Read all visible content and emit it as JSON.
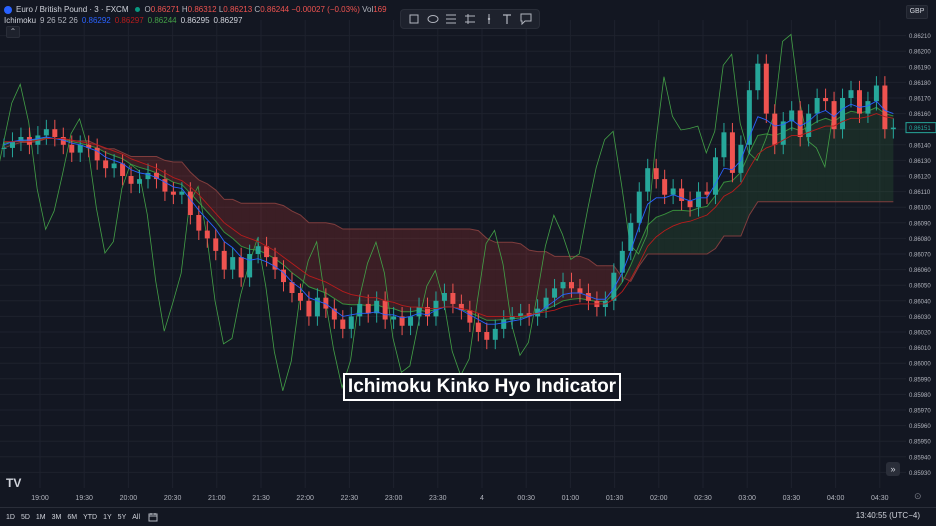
{
  "symbol": {
    "title": "Euro / British Pound · 3 · FXCM",
    "ohlc": [
      {
        "k": "O",
        "v": "0.86271"
      },
      {
        "k": "H",
        "v": "0.86312"
      },
      {
        "k": "L",
        "v": "0.86213"
      },
      {
        "k": "C",
        "v": "0.86244"
      }
    ],
    "change": "−0.00027 (−0.03%)",
    "vol_label": "Vol",
    "vol_value": "169"
  },
  "indicator": {
    "name": "Ichimoku",
    "params": "9 26 52 26",
    "values": [
      {
        "v": "0.86292",
        "color": "#2962ff"
      },
      {
        "v": "0.86297",
        "color": "#b71c1c"
      },
      {
        "v": "0.86244",
        "color": "#43a047"
      },
      {
        "v": "0.86295",
        "color": "#d1d4dc"
      },
      {
        "v": "0.86297",
        "color": "#d1d4dc"
      }
    ]
  },
  "currency": "GBP",
  "overlay_title": "Ichimoku Kinko Hyo Indicator",
  "logo": "TV",
  "toolbar_icons": [
    "rectangle-icon",
    "ellipse-icon",
    "fib-retracement-icon",
    "gann-icon",
    "vertical-line-icon",
    "text-icon",
    "callout-icon"
  ],
  "ranges": [
    "1D",
    "5D",
    "1M",
    "3M",
    "6M",
    "YTD",
    "1Y",
    "5Y",
    "All"
  ],
  "clock": "13:40:55 (UTC−4)",
  "colors": {
    "background": "#131722",
    "up": "#26a69a",
    "down": "#ef5350",
    "tenkan": "#2962ff",
    "kijun": "#b71c1c",
    "chikou": "#43a047",
    "cloud_bull": "rgba(67,160,71,0.15)",
    "cloud_bear": "rgba(244,67,54,0.18)"
  },
  "chart_data": {
    "type": "candlestick",
    "ylim": [
      0.8592,
      0.8622
    ],
    "y_ticks": [
      0.8593,
      0.8594,
      0.8595,
      0.8596,
      0.8597,
      0.8598,
      0.8599,
      0.86,
      0.8601,
      0.8602,
      0.8603,
      0.8604,
      0.8605,
      0.8606,
      0.8607,
      0.8608,
      0.8609,
      0.861,
      0.8611,
      0.8612,
      0.8613,
      0.8614,
      0.8615,
      0.8616,
      0.8617,
      0.8618,
      0.8619,
      0.862,
      0.8621
    ],
    "x_tick_labels": [
      "19:00",
      "19:30",
      "20:00",
      "20:30",
      "21:00",
      "21:30",
      "22:00",
      "22:30",
      "23:00",
      "23:30",
      "4",
      "00:30",
      "01:00",
      "01:30",
      "02:00",
      "02:30",
      "03:00",
      "03:30",
      "04:00",
      "04:30"
    ],
    "current_price": 0.86151,
    "current_price_label": "0.86151",
    "close": [
      0.86138,
      0.86142,
      0.86145,
      0.8614,
      0.86146,
      0.8615,
      0.86145,
      0.8614,
      0.86135,
      0.8614,
      0.86138,
      0.8613,
      0.86125,
      0.86128,
      0.8612,
      0.86115,
      0.86118,
      0.86122,
      0.86118,
      0.8611,
      0.86108,
      0.8611,
      0.86095,
      0.86085,
      0.8608,
      0.86072,
      0.8606,
      0.86068,
      0.86055,
      0.8607,
      0.86075,
      0.86068,
      0.8606,
      0.86052,
      0.86045,
      0.8604,
      0.8603,
      0.86042,
      0.86035,
      0.86028,
      0.86022,
      0.8603,
      0.86038,
      0.86032,
      0.8604,
      0.86028,
      0.8603,
      0.86024,
      0.8603,
      0.86036,
      0.8603,
      0.8604,
      0.86045,
      0.86038,
      0.86034,
      0.86026,
      0.8602,
      0.86015,
      0.86022,
      0.86028,
      0.8603,
      0.86032,
      0.8603,
      0.86035,
      0.86042,
      0.86048,
      0.86052,
      0.86048,
      0.86045,
      0.8604,
      0.86036,
      0.8604,
      0.86058,
      0.86072,
      0.8609,
      0.8611,
      0.86125,
      0.86118,
      0.86108,
      0.86112,
      0.86104,
      0.861,
      0.8611,
      0.86108,
      0.86132,
      0.86148,
      0.86122,
      0.8614,
      0.86175,
      0.86192,
      0.8616,
      0.8614,
      0.86155,
      0.86162,
      0.86145,
      0.8616,
      0.8617,
      0.86168,
      0.8615,
      0.8617,
      0.86175,
      0.8616,
      0.86168,
      0.86178,
      0.8615,
      0.86151
    ],
    "tenkan": [
      0.8614,
      0.86142,
      0.86143,
      0.86143,
      0.86144,
      0.86145,
      0.86144,
      0.86143,
      0.86141,
      0.8614,
      0.86138,
      0.86136,
      0.86132,
      0.8613,
      0.86128,
      0.86124,
      0.86122,
      0.86121,
      0.86119,
      0.86116,
      0.86113,
      0.86112,
      0.86105,
      0.86098,
      0.86092,
      0.86086,
      0.86078,
      0.86074,
      0.86068,
      0.86066,
      0.86067,
      0.86065,
      0.86062,
      0.86058,
      0.86052,
      0.86048,
      0.86042,
      0.8604,
      0.86038,
      0.86034,
      0.8603,
      0.86031,
      0.86032,
      0.86032,
      0.86033,
      0.86031,
      0.86031,
      0.86029,
      0.8603,
      0.86032,
      0.86031,
      0.86034,
      0.86036,
      0.86036,
      0.86034,
      0.86031,
      0.86028,
      0.86025,
      0.86025,
      0.86026,
      0.86027,
      0.86028,
      0.8603,
      0.86032,
      0.86036,
      0.8604,
      0.86044,
      0.86045,
      0.86045,
      0.86043,
      0.86041,
      0.86041,
      0.86048,
      0.86058,
      0.86072,
      0.86088,
      0.86102,
      0.86106,
      0.86106,
      0.86108,
      0.86106,
      0.86104,
      0.86106,
      0.86106,
      0.86115,
      0.86125,
      0.86124,
      0.8613,
      0.86145,
      0.86158,
      0.86156,
      0.86152,
      0.86153,
      0.86156,
      0.86152,
      0.86155,
      0.8616,
      0.86162,
      0.86158,
      0.86163,
      0.86166,
      0.86164,
      0.86165,
      0.86168,
      0.86162,
      0.8616
    ],
    "kijun": [
      0.86142,
      0.86142,
      0.86142,
      0.86142,
      0.86143,
      0.86144,
      0.86144,
      0.86144,
      0.86143,
      0.86142,
      0.86141,
      0.8614,
      0.86138,
      0.86136,
      0.86134,
      0.86131,
      0.86129,
      0.86127,
      0.86125,
      0.86122,
      0.86119,
      0.86117,
      0.86113,
      0.86108,
      0.86102,
      0.86096,
      0.8609,
      0.86086,
      0.86082,
      0.8608,
      0.86078,
      0.86075,
      0.86072,
      0.86068,
      0.86064,
      0.8606,
      0.86056,
      0.86054,
      0.86052,
      0.86049,
      0.86046,
      0.86044,
      0.86043,
      0.86042,
      0.86042,
      0.8604,
      0.86039,
      0.86037,
      0.86036,
      0.86036,
      0.86035,
      0.86035,
      0.86036,
      0.86036,
      0.86035,
      0.86034,
      0.86032,
      0.8603,
      0.8603,
      0.8603,
      0.8603,
      0.8603,
      0.86031,
      0.86032,
      0.86033,
      0.86034,
      0.86036,
      0.86037,
      0.86038,
      0.86038,
      0.86038,
      0.86038,
      0.86041,
      0.86046,
      0.86054,
      0.86064,
      0.86075,
      0.86081,
      0.86085,
      0.86088,
      0.8609,
      0.86091,
      0.86093,
      0.86095,
      0.861,
      0.86107,
      0.8611,
      0.86115,
      0.86125,
      0.86134,
      0.86138,
      0.8614,
      0.86143,
      0.86146,
      0.86146,
      0.86148,
      0.8615,
      0.86152,
      0.86152,
      0.86155,
      0.86157,
      0.86157,
      0.86158,
      0.8616,
      0.86158,
      0.86157
    ],
    "chikou_lag": 26,
    "senkou_lead": 26
  }
}
